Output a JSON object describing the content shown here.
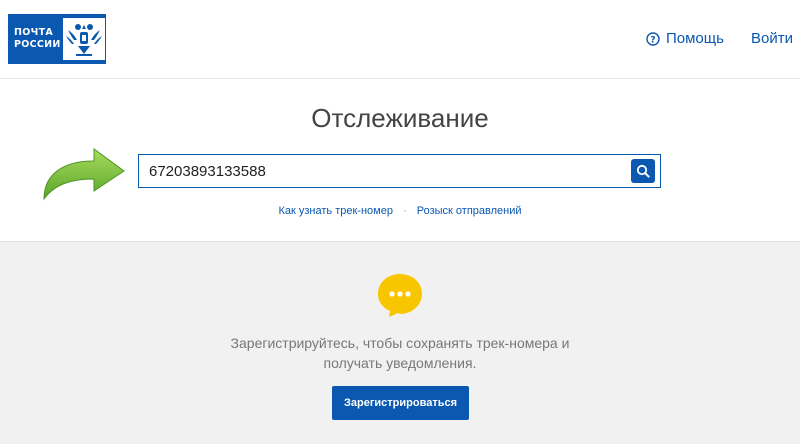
{
  "header": {
    "logo_line1": "ПОЧТА",
    "logo_line2": "РОССИИ",
    "help_label": "Помощь",
    "login_label": "Войти"
  },
  "tracking": {
    "title": "Отслеживание",
    "input_value": "67203893133588",
    "link_how": "Как узнать трек-номер",
    "separator": "·",
    "link_search": "Розыск отправлений"
  },
  "promo": {
    "line1": "Зарегистрируйтесь, чтобы сохранять трек-номера и",
    "line2": "получать уведомления.",
    "register_label": "Зарегистрироваться"
  },
  "icons": {
    "help": "question-circle-icon",
    "search": "magnifier-icon",
    "arrow": "green-curved-arrow-icon",
    "chat": "chat-dots-icon"
  },
  "colors": {
    "brand_blue": "#0a58b0",
    "arrow_green": "#7cc242",
    "chat_yellow": "#f7c600",
    "page_background": "#f1f1f1"
  }
}
